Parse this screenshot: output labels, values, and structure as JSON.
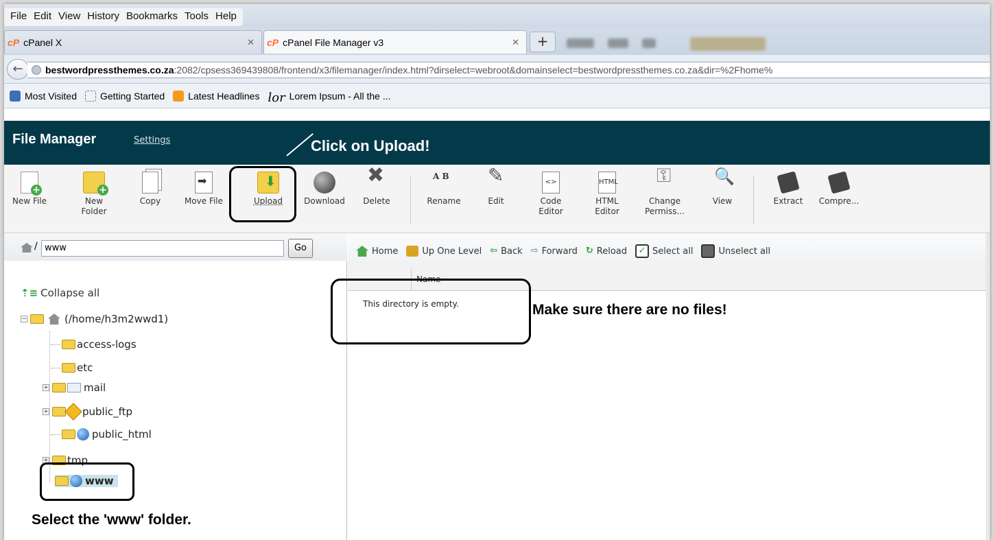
{
  "browser": {
    "menu": [
      "File",
      "Edit",
      "View",
      "History",
      "Bookmarks",
      "Tools",
      "Help"
    ],
    "tabs": [
      {
        "label": "cPanel X",
        "active": false
      },
      {
        "label": "cPanel File Manager v3",
        "active": true
      }
    ],
    "tab_logo": "cP",
    "new_tab": "+",
    "url_host": "bestwordpressthemes.co.za",
    "url_rest": ":2082/cpsess369439808/frontend/x3/filemanager/index.html?dirselect=webroot&domainselect=bestwordpressthemes.co.za&dir=%2Fhome%",
    "bookmarks": [
      "Most Visited",
      "Getting Started",
      "Latest Headlines",
      "Lorem Ipsum - All the ..."
    ],
    "lor_glyph": "lor"
  },
  "header": {
    "title": "File Manager",
    "settings": "Settings"
  },
  "toolbar": [
    {
      "label": "New File",
      "icon": "new-file-icon"
    },
    {
      "label": "New\nFolder",
      "icon": "new-folder-icon"
    },
    {
      "label": "Copy",
      "icon": "copy-icon"
    },
    {
      "label": "Move File",
      "icon": "move-file-icon"
    },
    {
      "label": "Upload",
      "icon": "upload-icon"
    },
    {
      "label": "Download",
      "icon": "download-icon"
    },
    {
      "label": "Delete",
      "icon": "delete-icon"
    },
    {
      "label": "Rename",
      "icon": "rename-icon"
    },
    {
      "label": "Edit",
      "icon": "edit-icon"
    },
    {
      "label": "Code\nEditor",
      "icon": "code-editor-icon"
    },
    {
      "label": "HTML\nEditor",
      "icon": "html-editor-icon"
    },
    {
      "label": "Change\nPermiss...",
      "icon": "permissions-icon"
    },
    {
      "label": "View",
      "icon": "view-icon"
    },
    {
      "label": "Extract",
      "icon": "extract-icon"
    },
    {
      "label": "Compre...",
      "icon": "compress-icon"
    }
  ],
  "icon_text": {
    "rename": "A B",
    "code": "<>",
    "html": "HTML"
  },
  "tree": {
    "path_value": "www",
    "path_slash": "/",
    "go": "Go",
    "collapse_all": "Collapse all",
    "collapse_glyph": "⇡≡",
    "root": "(/home/h3m2wwd1)",
    "items": [
      "access-logs",
      "etc",
      "mail",
      "public_ftp",
      "public_html",
      "tmp",
      "www"
    ],
    "selected": "www"
  },
  "nav": {
    "home": "Home",
    "up": "Up One Level",
    "back": "Back",
    "back_glyph": "⇦",
    "forward": "Forward",
    "forward_glyph": "⇨",
    "reload": "Reload",
    "reload_glyph": "↻",
    "select_all": "Select all",
    "check_glyph": "✓",
    "unselect_all": "Unselect all"
  },
  "listing": {
    "column_name": "Name",
    "empty_message": "This directory is empty."
  },
  "annotations": {
    "upload": "Click on Upload!",
    "no_files": "Make sure there are no files!",
    "select_www": "Select the 'www' folder."
  },
  "colors": {
    "header_bg": "#04394a",
    "cpanel_orange": "#ff6c2c",
    "selection": "#c9e3ea"
  }
}
